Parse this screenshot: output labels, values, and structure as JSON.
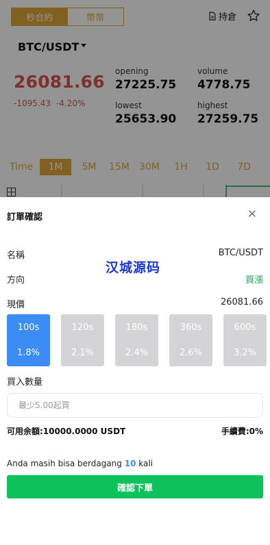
{
  "background": {
    "tabs": [
      {
        "label": "秒合約",
        "active": true
      },
      {
        "label": "幣幣",
        "active": false
      }
    ],
    "hold_label": "持倉",
    "pair": "BTC/USDT",
    "price": "26081.66",
    "change_amount": "-1095.43",
    "change_percent": "-4.20%",
    "stats": {
      "opening_label": "opening",
      "opening_value": "27225.75",
      "volume_label": "volume",
      "volume_value": "4778.75",
      "lowest_label": "lowest",
      "lowest_value": "25653.90",
      "highest_label": "highest",
      "highest_value": "27259.75"
    },
    "intervals": [
      "Time",
      "1M",
      "5M",
      "15M",
      "30M",
      "1H",
      "1D",
      "7D"
    ],
    "active_interval": "1M"
  },
  "sheet": {
    "title": "訂單確認",
    "watermark": "汉城源码",
    "name_label": "名稱",
    "name_value": "BTC/USDT",
    "direction_label": "方向",
    "direction_value": "買漲",
    "price_label": "現價",
    "price_value": "26081.66",
    "durations": [
      {
        "time": "100s",
        "rate": "1.8%",
        "active": true
      },
      {
        "time": "120s",
        "rate": "2.1%",
        "active": false
      },
      {
        "time": "180s",
        "rate": "2.4%",
        "active": false
      },
      {
        "time": "360s",
        "rate": "2.6%",
        "active": false
      },
      {
        "time": "600s",
        "rate": "3.2%",
        "active": false
      }
    ],
    "qty_label": "買入數量",
    "qty_placeholder": "最少5.00起買",
    "balance_text": "可用余額:10000.0000 USDT",
    "fee_text": "手續費:0%",
    "note_prefix": "Anda masih bisa berdagang",
    "note_count": "10",
    "note_suffix": "kali",
    "confirm_label": "確認下單"
  },
  "colors": {
    "accent": "#e0a53a",
    "down": "#d9534f",
    "up": "#1aa05b",
    "selected": "#3b8cf5",
    "confirm": "#0dc25c"
  }
}
